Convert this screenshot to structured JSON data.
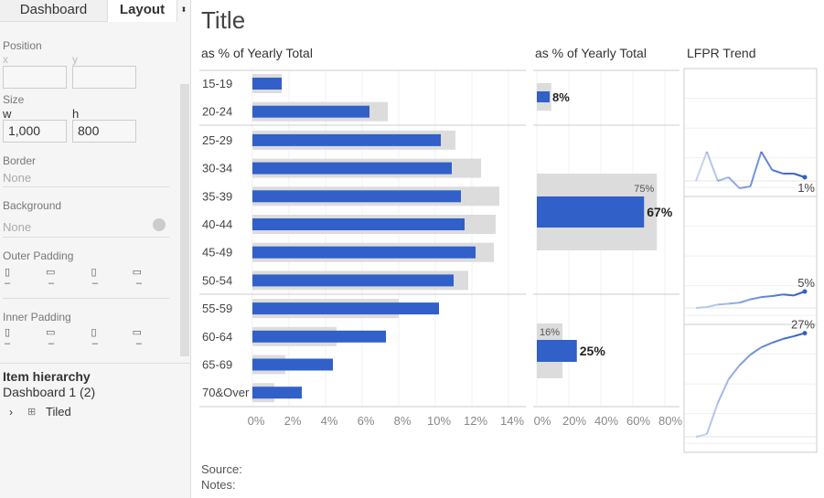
{
  "sidebar": {
    "tabs": [
      "Dashboard",
      "Layout"
    ],
    "position_label": "Position",
    "x_label": "x",
    "y_label": "y",
    "size_label": "Size",
    "w_label": "w",
    "h_label": "h",
    "w_value": "1,000",
    "h_value": "800",
    "border_label": "Border",
    "border_value": "None",
    "background_label": "Background",
    "background_value": "None",
    "outer_padding_label": "Outer Padding",
    "inner_padding_label": "Inner Padding",
    "padding_value": "–",
    "hierarchy_title": "Item hierarchy",
    "hierarchy_root": "Dashboard 1 (2)",
    "hierarchy_child": "Tiled"
  },
  "dashboard": {
    "title": "Title",
    "source": "Source:",
    "notes": "Notes:"
  },
  "colors": {
    "blue": "#3060c8",
    "gray": "#dcdcdc"
  },
  "chart_data": [
    {
      "type": "bar",
      "title": "as % of Yearly Total",
      "categories": [
        "15-19",
        "20-24",
        "25-29",
        "30-34",
        "35-39",
        "40-44",
        "45-49",
        "50-54",
        "55-59",
        "60-64",
        "65-69",
        "70&Over"
      ],
      "groups": [
        [
          0,
          1
        ],
        [
          2,
          3,
          4,
          5,
          6,
          7
        ],
        [
          8,
          9,
          10,
          11
        ]
      ],
      "series": [
        {
          "values": [
            1.6,
            6.4,
            10.3,
            10.9,
            11.4,
            11.6,
            12.2,
            11.0,
            10.2,
            7.3,
            4.4,
            2.7
          ]
        },
        {
          "values": [
            1.6,
            7.4,
            11.1,
            12.5,
            13.5,
            13.3,
            13.2,
            11.8,
            8.0,
            4.6,
            1.8,
            1.2
          ]
        }
      ],
      "xticks": [
        "0%",
        "2%",
        "4%",
        "6%",
        "8%",
        "10%",
        "12%",
        "14%"
      ],
      "xlim": [
        0,
        14
      ]
    },
    {
      "type": "bar",
      "title": "as % of Yearly Total",
      "series": [
        {
          "values": [
            8,
            67,
            25
          ],
          "labels": [
            "8%",
            "67%",
            "25%"
          ]
        },
        {
          "values": [
            9,
            75,
            16
          ],
          "labels": [
            "",
            "75%",
            "16%"
          ]
        }
      ],
      "xticks": [
        "0%",
        "20%",
        "40%",
        "60%",
        "80%"
      ],
      "xlim": [
        0,
        80
      ]
    },
    {
      "type": "line",
      "title": "LFPR Trend",
      "series": [
        {
          "values": [
            0,
            8,
            0,
            1,
            -2,
            -1.5,
            8,
            3,
            2,
            2,
            1
          ],
          "end_label": "1%"
        },
        {
          "values": [
            0,
            0.3,
            1,
            1.3,
            1.6,
            2.6,
            3.3,
            3.6,
            4.1,
            3.8,
            5
          ],
          "end_label": "5%"
        },
        {
          "values": [
            0,
            0.7,
            8.8,
            15,
            18.6,
            21.4,
            23.3,
            24.5,
            25.5,
            26.2,
            27
          ],
          "end_label": "27%"
        }
      ]
    }
  ]
}
